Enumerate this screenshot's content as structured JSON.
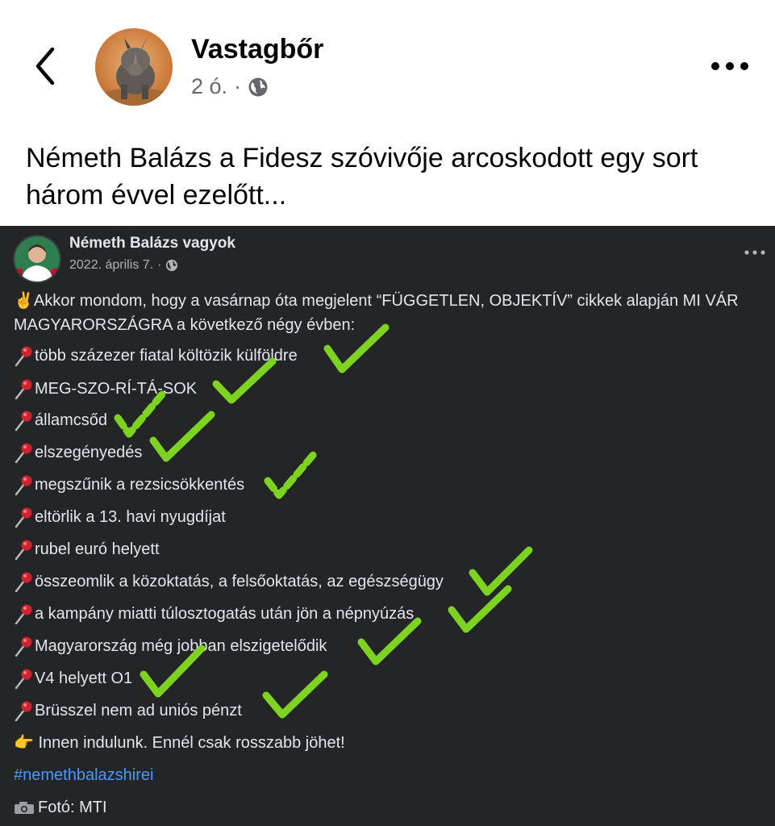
{
  "post": {
    "author": "Vastagbőr",
    "time": "2 ó.",
    "dot": "·",
    "text": "Németh Balázs a Fidesz szóvivője arcoskodott egy sort három évvel ezelőtt..."
  },
  "icons": {
    "back": "chevron-left-icon",
    "more": "more-dots-icon",
    "audience": "globe-icon"
  },
  "embedded": {
    "author": "Németh Balázs vagyok",
    "date": "2022. április 7.",
    "dot": "·",
    "intro": "✌️Akkor mondom, hogy a vasárnap óta megjelent “FÜGGETLEN, OBJEKTÍV” cikkek alapján MI VÁR MAGYARORSZÁGRA a következő négy évben:",
    "items": [
      "több százezer fiatal költözik külföldre",
      "MEG-SZO-RÍ-TÁ-SOK",
      "államcsőd",
      "elszegényedés",
      "megszűnik a rezsicsökkentés",
      "eltörlik a 13. havi nyugdíjat",
      "rubel euró helyett",
      "összeomlik a közoktatás, a felsőoktatás, az egészségügy",
      "a kampány miatti túlosztogatás után jön a népnyúzás",
      "Magyarország még jobban elszigetelődik",
      "V4 helyett O1",
      "Brüsszel nem ad uniós pénzt"
    ],
    "closing": "👉 Innen indulunk. Ennél csak rosszabb jöhet!",
    "hashtag": "#nemethbalazshirei",
    "photo_credit": "Fotó: MTI"
  },
  "colors": {
    "dark_bg": "#242526",
    "check_green": "#7ed321",
    "hashtag_blue": "#4599ff",
    "pin_red": "#d0232e"
  }
}
